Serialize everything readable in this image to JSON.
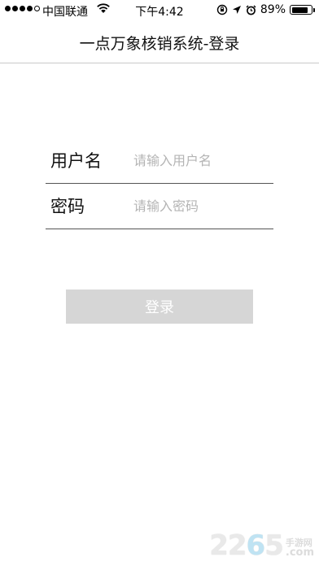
{
  "status_bar": {
    "carrier": "中国联通",
    "time": "下午4:42",
    "battery": "89%",
    "battery_level": 0.89,
    "icons": [
      "signal-dots-icon",
      "wifi-icon",
      "rotation-lock-icon",
      "location-icon",
      "alarm-icon",
      "battery-icon"
    ]
  },
  "nav": {
    "title": "一点万象核销系统-登录"
  },
  "form": {
    "username": {
      "label": "用户名",
      "placeholder": "请输入用户名",
      "value": ""
    },
    "password": {
      "label": "密码",
      "placeholder": "请输入密码",
      "value": ""
    },
    "login_label": "登录"
  },
  "colors": {
    "button_disabled": "#d6d6d6",
    "placeholder": "#b4b4b4",
    "divider": "#555555"
  },
  "watermark": {
    "digits": "2265",
    "sub": "手游网",
    "domain": ".com"
  }
}
